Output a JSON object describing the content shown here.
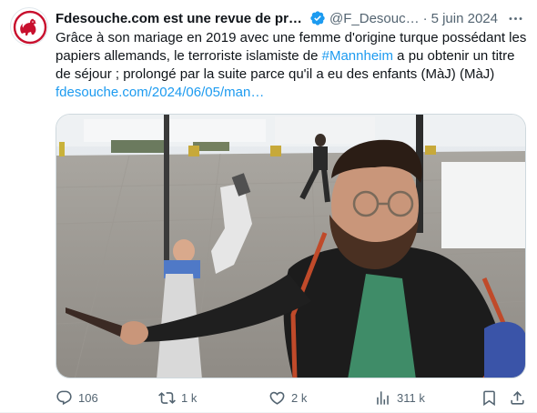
{
  "tweet": {
    "author_name": "Fdesouche.com est une revue de pres…",
    "handle": "@F_Desouc…",
    "separator": "·",
    "date": "5 juin 2024",
    "text_part1": "Grâce à son mariage en 2019 avec une femme d'origine turque possédant les papiers allemands, le terroriste islamiste de ",
    "hashtag": "#Mannheim",
    "text_part2": " a pu obtenir un titre de séjour ; prolongé par la suite parce qu'il a eu des enfants (MàJ) (MàJ)",
    "link": "fdesouche.com/2024/06/05/man…",
    "avatar_icon": "rooster-logo-icon",
    "verified_icon": "verified-badge-icon",
    "accent_color": "#1d9bf0",
    "avatar_color": "#c8102e"
  },
  "actions": {
    "reply_count": "106",
    "retweet_count": "1 k",
    "like_count": "2 k",
    "views_count": "311 k"
  }
}
